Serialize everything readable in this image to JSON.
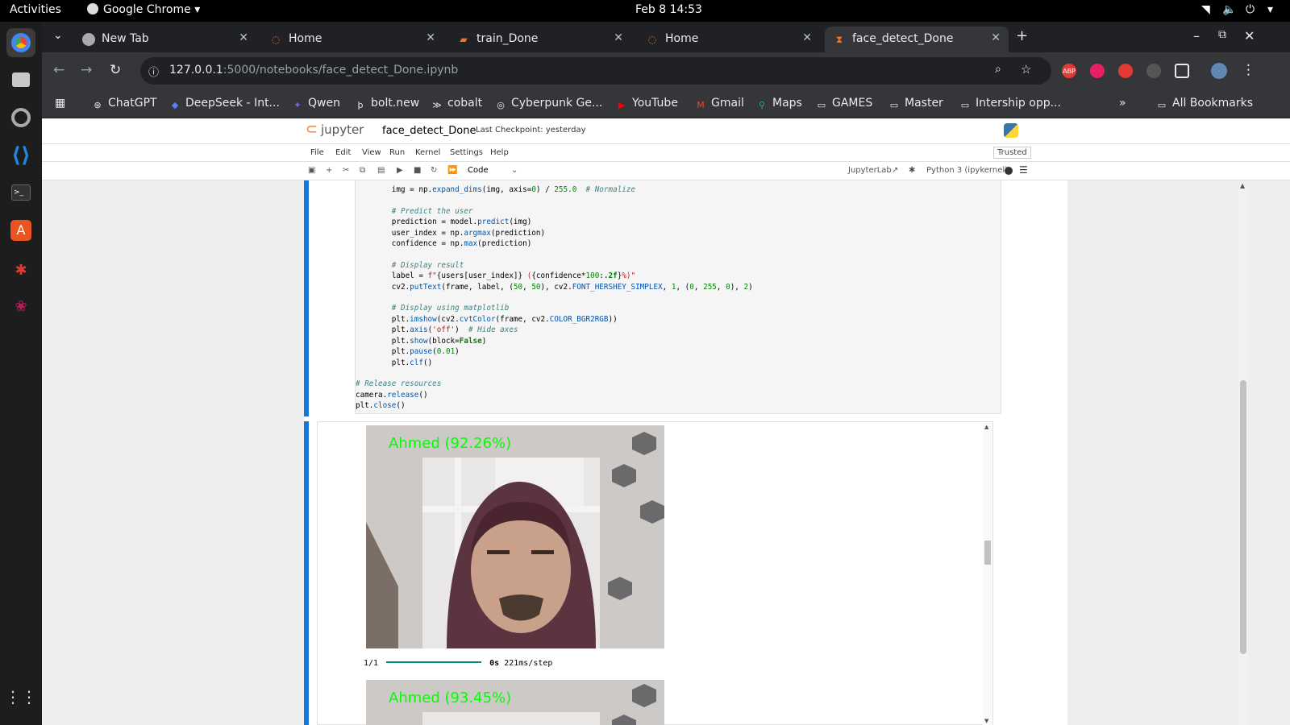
{
  "system": {
    "activities": "Activities",
    "app": "Google Chrome",
    "clock": "Feb 8  14:53"
  },
  "tabs": [
    {
      "title": "New Tab"
    },
    {
      "title": "Home"
    },
    {
      "title": "train_Done"
    },
    {
      "title": "Home"
    },
    {
      "title": "face_detect_Done"
    }
  ],
  "address": {
    "host": "127.0.0.1",
    "path": ":5000/notebooks/face_detect_Done.ipynb"
  },
  "extensions": [
    "ABP"
  ],
  "bookmarks": [
    "ChatGPT",
    "DeepSeek - Int...",
    "Qwen",
    "bolt.new",
    "cobalt",
    "Cyberpunk Ge...",
    "YouTube",
    "Gmail",
    "Maps",
    "GAMES",
    "Master",
    "Intership opp..."
  ],
  "bookmarks_all": "All Bookmarks",
  "jupyter": {
    "logo": "jupyter",
    "notebook": "face_detect_Done",
    "checkpoint": "Last Checkpoint: yesterday",
    "menu": [
      "File",
      "Edit",
      "View",
      "Run",
      "Kernel",
      "Settings",
      "Help"
    ],
    "trusted": "Trusted",
    "cell_type": "Code",
    "jupyterlab": "JupyterLab",
    "kernel": "Python 3 (ipykernel)"
  },
  "outputs": [
    {
      "label": "Ahmed (92.26%)"
    },
    {
      "label": "Ahmed (93.45%)"
    }
  ],
  "progress": {
    "count": "1/1",
    "time": "0s",
    "rate": "221ms/step",
    "fraction": 1.0
  }
}
